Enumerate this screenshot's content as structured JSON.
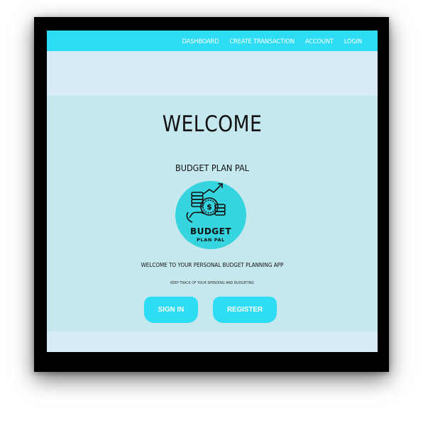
{
  "navbar": {
    "items": [
      {
        "label": "DASHBOARD"
      },
      {
        "label": "CREATE TRANSACTION"
      },
      {
        "label": "ACCOUNT"
      },
      {
        "label": "LOGIN"
      }
    ]
  },
  "hero": {
    "title": "WELCOME",
    "app_name": "BUDGET PLAN PAL",
    "logo": {
      "line1": "BUDGET",
      "line2": "PLAN PAL"
    },
    "tagline": "WELCOME TO YOUR PERSONAL BUDGET PLANNING APP",
    "subtagline": "KEEP TRACK OF YOUR SPENDING AND BUDGETING",
    "signin_label": "SIGN IN",
    "register_label": "REGISTER"
  },
  "colors": {
    "accent": "#2edcf4",
    "page_background": "#d6eaf8",
    "hero_background": "#c5e7ee",
    "logo_circle": "#35d4df"
  }
}
